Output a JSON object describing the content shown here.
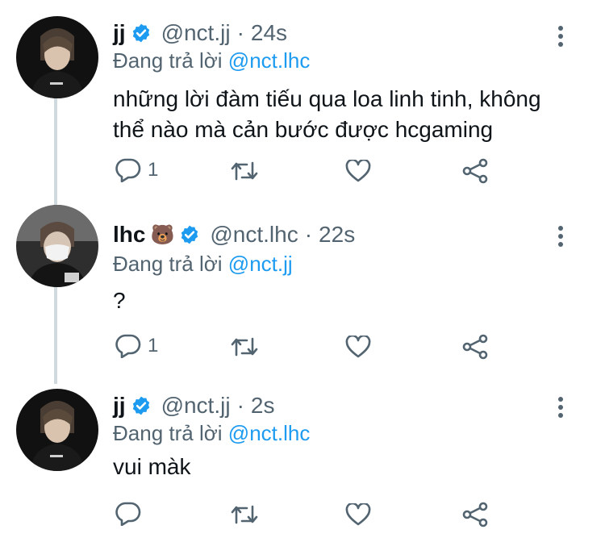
{
  "tweets": [
    {
      "name": "jj",
      "emoji": "",
      "handle": "@nct.jj",
      "time": "24s",
      "replying_prefix": "Đang trả lời",
      "replying_to": "@nct.lhc",
      "body_lines": [
        "những lời đàm tiếu qua loa linh tinh, không",
        "thể nào mà cản bước được hcgaming"
      ],
      "reply_count": "1"
    },
    {
      "name": "lhc",
      "emoji": "🐻",
      "handle": "@nct.lhc",
      "time": "22s",
      "replying_prefix": "Đang trả lời",
      "replying_to": "@nct.jj",
      "body_lines": [
        "?"
      ],
      "reply_count": "1"
    },
    {
      "name": "jj",
      "emoji": "",
      "handle": "@nct.jj",
      "time": "2s",
      "replying_prefix": "Đang trả lời",
      "replying_to": "@nct.lhc",
      "body_lines": [
        "vui màk"
      ],
      "reply_count": ""
    }
  ],
  "separator": "·",
  "icons": {
    "verified": "verified-badge-icon",
    "reply": "reply-icon",
    "retweet": "retweet-icon",
    "like": "like-icon",
    "share": "share-icon",
    "more": "more-icon"
  },
  "colors": {
    "accent": "#1d9bf0",
    "secondary_text": "#536471",
    "primary_text": "#0f1419"
  }
}
